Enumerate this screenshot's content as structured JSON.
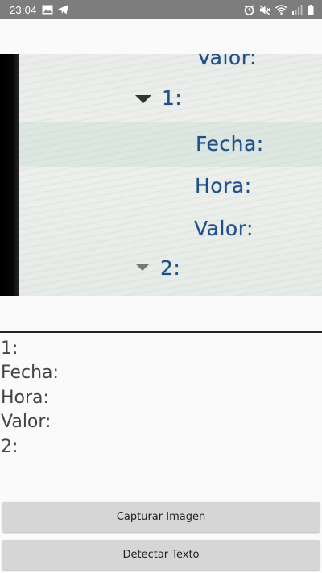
{
  "status_bar": {
    "time": "23:04",
    "left_icons": [
      "image-icon",
      "telegram-icon"
    ],
    "right_icons": [
      "alarm-icon",
      "mute-icon",
      "wifi-icon",
      "signal-icon",
      "battery-icon"
    ]
  },
  "camera_preview": {
    "lines": [
      "Valor:",
      "1:",
      "Fecha:",
      "Hora:",
      "Valor:",
      "2:"
    ]
  },
  "result": {
    "text": "1:\nFecha:\nHora:\nValor:\n2:"
  },
  "buttons": {
    "capture_label": "Capturar Imagen",
    "detect_label": "Detectar Texto"
  },
  "colors": {
    "status_bar_bg": "#7d7d7d",
    "app_bg": "#fafafa",
    "button_bg": "#d6d6d6",
    "preview_text": "#1e4f8a"
  }
}
